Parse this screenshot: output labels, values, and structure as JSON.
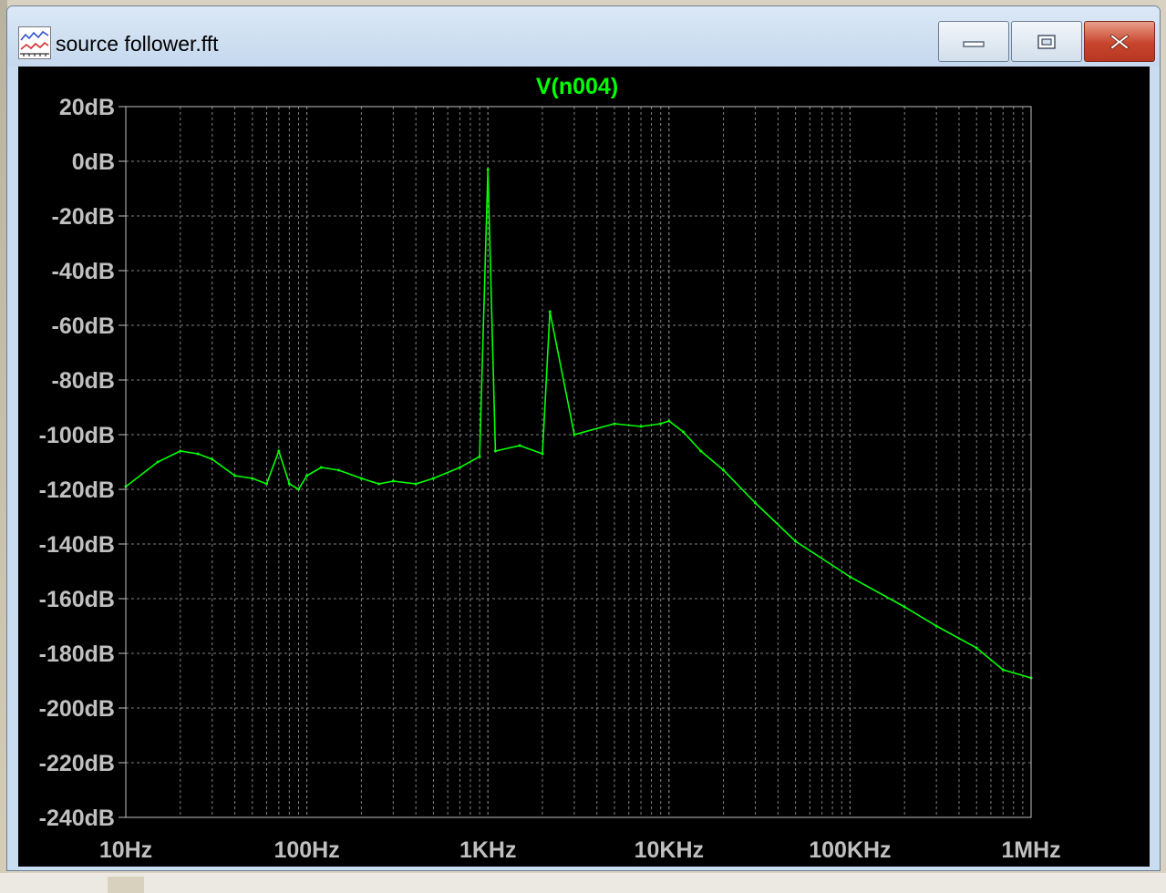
{
  "window": {
    "title": "source follower.fft",
    "icon": "waveform-icon",
    "buttons": {
      "minimize": "minimize-icon",
      "maximize": "maximize-icon",
      "close": "close-icon",
      "close_color": "#c8442c"
    }
  },
  "chart_data": {
    "type": "line",
    "title": "V(n004)",
    "xscale": "log",
    "xlim": [
      10,
      1000000
    ],
    "ylim": [
      -240,
      20
    ],
    "x_ticks": [
      10,
      100,
      1000,
      10000,
      100000,
      1000000
    ],
    "x_tick_labels": [
      "10Hz",
      "100Hz",
      "1KHz",
      "10KHz",
      "100KHz",
      "1MHz"
    ],
    "y_ticks": [
      20,
      0,
      -20,
      -40,
      -60,
      -80,
      -100,
      -120,
      -140,
      -160,
      -180,
      -200,
      -220,
      -240
    ],
    "y_tick_labels": [
      "20dB",
      "0dB",
      "-20dB",
      "-40dB",
      "-60dB",
      "-80dB",
      "-100dB",
      "-120dB",
      "-140dB",
      "-160dB",
      "-180dB",
      "-200dB",
      "-220dB",
      "-240dB"
    ],
    "grid": true,
    "colors": {
      "background": "#000000",
      "trace": "#00ff00",
      "title": "#00ff00",
      "axis_text": "#c0c0c0",
      "grid": "#808080"
    },
    "series": [
      {
        "name": "V(n004)",
        "x": [
          10,
          15,
          20,
          25,
          30,
          40,
          50,
          60,
          70,
          80,
          90,
          100,
          120,
          150,
          200,
          250,
          300,
          400,
          500,
          700,
          900,
          1000,
          1100,
          1500,
          2000,
          2200,
          3000,
          5000,
          7000,
          9000,
          10000,
          12000,
          15000,
          20000,
          30000,
          50000,
          100000,
          200000,
          300000,
          500000,
          700000,
          1000000
        ],
        "y": [
          -119,
          -110,
          -106,
          -107,
          -109,
          -115,
          -116,
          -118,
          -106,
          -118,
          -120,
          -115,
          -112,
          -113,
          -116,
          -118,
          -117,
          -118,
          -116,
          -112,
          -108,
          -3,
          -106,
          -104,
          -107,
          -55,
          -100,
          -96,
          -97,
          -96,
          -95,
          -99,
          -106,
          -113,
          -125,
          -139,
          -152,
          -163,
          -170,
          -178,
          -186,
          -189
        ]
      }
    ]
  }
}
